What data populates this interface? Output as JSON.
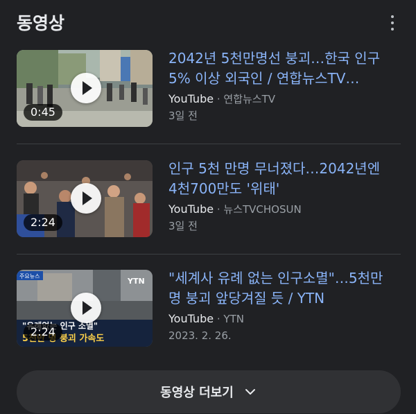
{
  "section": {
    "title": "동영상",
    "more_options_icon": "more-vert-icon"
  },
  "videos": [
    {
      "title": "2042년 5천만명선 붕괴…한국 인구\n5% 이상 외국인 / 연합뉴스TV…",
      "source": "YouTube",
      "separator": "·",
      "channel": "연합뉴스TV",
      "date": "3일 전",
      "duration": "0:45"
    },
    {
      "title": "인구 5천 만명 무너졌다…2042년엔\n4천700만도 '위태'",
      "source": "YouTube",
      "separator": "·",
      "channel": "뉴스TVCHOSUN",
      "date": "3일 전",
      "duration": "2:24"
    },
    {
      "title": "\"세계사 유례 없는 인구소멸\"…5천만\n명 붕괴 앞당겨질 듯 / YTN",
      "source": "YouTube",
      "separator": "·",
      "channel": "YTN",
      "date": "2023. 2. 26.",
      "duration": "2:24",
      "thumb_caption_1": "\"유례없는 인구 소멸\"",
      "thumb_caption_2": "5천만 명 붕괴 가속도",
      "thumb_logo": "YTN",
      "thumb_badge": "주요뉴스"
    }
  ],
  "more_button": {
    "label": "동영상 더보기",
    "icon": "chevron-down-icon"
  },
  "colors": {
    "background": "#202124",
    "title_link": "#8ab4f8",
    "button_bg": "#303134"
  }
}
